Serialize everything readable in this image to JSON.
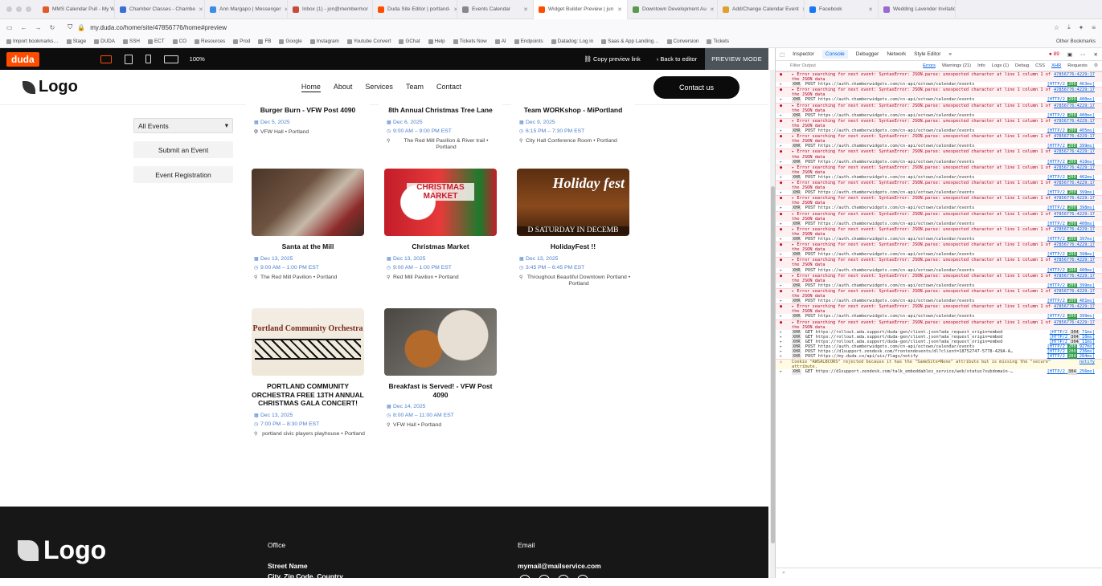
{
  "browser": {
    "tabs": [
      {
        "label": "MMS Calendar Pull - My Wo",
        "color": "#e05a2a"
      },
      {
        "label": "Chamber Classes - Chambe",
        "color": "#3b6fd8"
      },
      {
        "label": "Ann Margapo | Messenger",
        "color": "#3a8ee6"
      },
      {
        "label": "Inbox (1) - jon@membermor",
        "color": "#c94a3c"
      },
      {
        "label": "Duda Site Editor | portland-",
        "color": "#ff4d00"
      },
      {
        "label": "Events Calendar",
        "color": "#888888"
      },
      {
        "label": "Widget Builder Preview | jun",
        "color": "#ff4d00",
        "active": true
      },
      {
        "label": "Downtown Development Au",
        "color": "#5a9a4a"
      },
      {
        "label": "Add/Change Calendar Event",
        "color": "#e0a030"
      },
      {
        "label": "Facebook",
        "color": "#1877f2"
      },
      {
        "label": "Wedding Lavender Invitatio",
        "color": "#9a6ad0"
      }
    ],
    "url": "my.duda.co/home/site/478567​76/home#preview",
    "bookmarks": [
      "Import bookmarks…",
      "Stage",
      "DUDA",
      "SSH",
      "ECT",
      "CO",
      "Resources",
      "Prod",
      "FB",
      "Google",
      "Instagram",
      "Youtube Convert",
      "GChat",
      "Help",
      "Tickets Now",
      "AI",
      "Endpoints",
      "Datadog: Log in",
      "Saas & App Landing…",
      "Conversion",
      "Tickets"
    ],
    "other_bookmarks": "Other Bookmarks"
  },
  "duda": {
    "logo": "duda",
    "zoom": "100%",
    "copy_link": "Copy preview link",
    "back": "Back to editor",
    "mode": "PREVIEW MODE"
  },
  "site": {
    "logo": "Logo",
    "nav": [
      "Home",
      "About",
      "Services",
      "Team",
      "Contact"
    ],
    "contact_button": "Contact us",
    "filter_selected": "All Events",
    "submit_button": "Submit an Event",
    "registration_button": "Event Registration"
  },
  "events": [
    {
      "title": "Burger Burn - VFW Post 4090",
      "date": "Dec 5, 2025",
      "time": "",
      "location": "VFW Hall • Portland",
      "image": "none"
    },
    {
      "title": "8th Annual Christmas Tree Lane",
      "date": "Dec 6, 2025",
      "time": "9:00 AM – 9:00 PM EST",
      "location": "The Red Mill Pavilion & River trail • Portland",
      "image": "none"
    },
    {
      "title": "Team WORKshop - MiPortland",
      "date": "Dec 9, 2025",
      "time": "6:15 PM – 7:30 PM EST",
      "location": "City Hall Conference Room • Portland",
      "image": "none"
    },
    {
      "title": "Santa at the Mill",
      "date": "Dec 13, 2025",
      "time": "9:00 AM – 1:00 PM EST",
      "location": "The Red Mill Pavilion • Portland",
      "image": "santa"
    },
    {
      "title": "Christmas Market",
      "date": "Dec 13, 2025",
      "time": "9:00 AM – 1:00 PM EST",
      "location": "Red Mill Pavilion • Portland",
      "image": "market",
      "image_text": "CHRISTMAS MARKET"
    },
    {
      "title": "HolidayFest !!",
      "date": "Dec 13, 2025",
      "time": "3:45 PM – 6:45 PM EST",
      "location": "Throughout Beautiful Downtown Portland • Portland",
      "image": "holiday",
      "image_text": "Holiday fest",
      "image_text2": "D SATURDAY IN DECEMB"
    },
    {
      "title": "PORTLAND COMMUNITY ORCHESTRA FREE 13TH ANNUAL CHRISTMAS GALA CONCERT!",
      "date": "Dec 13, 2025",
      "time": "7:00 PM – 8:30 PM EST",
      "location": "portland civic players playhouse • Portland",
      "image": "orchestra",
      "image_text": "Portland Community Orchestra"
    },
    {
      "title": "Breakfast is Served! - VFW Post 4090",
      "date": "Dec 14, 2025",
      "time": "8:00 AM – 11:00 AM EST",
      "location": "VFW Hall • Portland",
      "image": "breakfast"
    }
  ],
  "footer": {
    "logo": "Logo",
    "office_heading": "Office",
    "street": "Street Name",
    "city": "City, Zip Code, Country",
    "email_heading": "Email",
    "email": "mymail@mailservice.com"
  },
  "devtools": {
    "tabs": [
      "Inspector",
      "Console",
      "Debugger",
      "Network",
      "Style Editor"
    ],
    "active_tab": "Console",
    "error_count": "89",
    "filter_placeholder": "Filter Output",
    "filters": [
      "Errors",
      "Warnings (21)",
      "Info",
      "Logs (1)",
      "Debug",
      "CSS",
      "XHR",
      "Requests"
    ],
    "post_url": "https://auth.chamberwidgets.com/cn-api/ectown/calendar/events",
    "error_text": "Error searching for next event: SyntaxError: JSON.parse: unexpected character at line 1 column 1 of the JSON data",
    "error_source": "47856776:4229:17",
    "post_results": [
      "[HTTP/2 200 463ms]",
      "[HTTP/2 200 400ms]",
      "[HTTP/2 200 400ms]",
      "[HTTP/2 200 405ms]",
      "[HTTP/2 200 399ms]",
      "[HTTP/2 200 410ms]",
      "[HTTP/2 200 402ms]",
      "[HTTP/2 200 399ms]",
      "[HTTP/2 200 398ms]",
      "[HTTP/2 200 400ms]",
      "[HTTP/2 200 397ms]",
      "[HTTP/2 200 398ms]",
      "[HTTP/2 200 400ms]",
      "[HTTP/2 200 399ms]",
      "[HTTP/2 200 401ms]",
      "[HTTP/2 200 399ms]"
    ],
    "tail": [
      {
        "method": "GET",
        "url": "https://rollout.ada.support/duda-gen/client.json?ada_request_origin=embed",
        "result": "[HTTP/2 304 71ms]"
      },
      {
        "method": "GET",
        "url": "https://rollout.ada.support/duda-gen/client.json?ada_request_origin=embed",
        "result": "[HTTP/2 304 10ms]"
      },
      {
        "method": "GET",
        "url": "https://rollout.ada.support/duda-gen/client.json?ada_request_origin=embed",
        "result": "[HTTP/2 304 11ms]"
      },
      {
        "method": "POST",
        "url": "https://auth.chamberwidgets.com/cn-api/ectown/calendar/events",
        "result": "[HTTP/2 200 927ms]"
      },
      {
        "method": "POST",
        "url": "https://d1support.zendesk.com/frontendevents/dl?client=18752747-5778-429A-A…",
        "result": "[HTTP/2 200 236ms]"
      },
      {
        "method": "POST",
        "url": "https://my.duda.co/api/uis/flags/notify",
        "result": "[HTTP/2 204 284ms]"
      }
    ],
    "cookie_warning": "Cookie \"AWSALBCORS\" rejected because it has the \"SameSite=None\" attribute but is missing the \"secure\" attribute.",
    "cookie_source": "notify",
    "last": {
      "method": "GET",
      "url": "https://d1support.zendesk.com/talk_embeddables_service/web/status?subdomain-…",
      "result": "[HTTP/2 304 256ms]"
    }
  },
  "colors": {
    "duda_orange": "#ff4d00",
    "link_blue": "#4a7fcc",
    "error_red": "#d70022"
  }
}
